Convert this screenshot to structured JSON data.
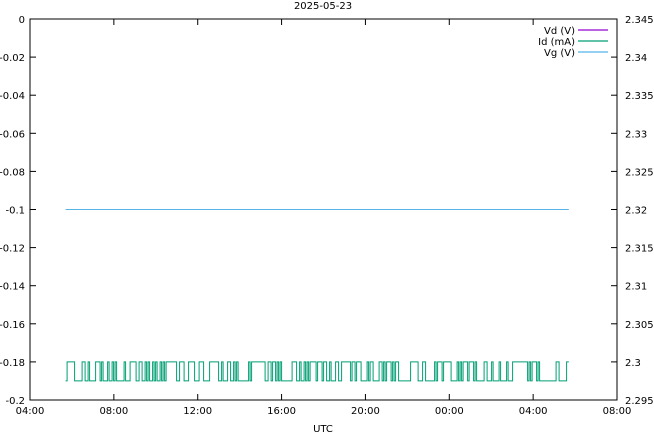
{
  "chart_data": {
    "type": "line",
    "title": "2025-05-23",
    "xlabel": "UTC",
    "ylabel_left": "",
    "ylabel_right": "",
    "x_ticks": [
      "04:00",
      "08:00",
      "12:00",
      "16:00",
      "20:00",
      "00:00",
      "04:00",
      "08:00"
    ],
    "x_range_hours": [
      4,
      32
    ],
    "y_left_range": [
      -0.2,
      0
    ],
    "y_left_ticks": [
      "0",
      "-0.02",
      "-0.04",
      "-0.06",
      "-0.08",
      "-0.1",
      "-0.12",
      "-0.14",
      "-0.16",
      "-0.18",
      "-0.2"
    ],
    "y_right_range": [
      2.295,
      2.345
    ],
    "y_right_ticks": [
      "2.345",
      "2.34",
      "2.335",
      "2.33",
      "2.325",
      "2.32",
      "2.315",
      "2.31",
      "2.305",
      "2.3",
      "2.295"
    ],
    "legend_position": "top-right",
    "grid": false,
    "series": [
      {
        "name": "Vd (V)",
        "color": "#9400d3",
        "axis": "right",
        "t_start_hours": 5.7,
        "t_end_hours": 29.7,
        "value": null,
        "note": "not visible in plotted range"
      },
      {
        "name": "Id (mA)",
        "color": "#009e73",
        "axis": "left",
        "t_start_hours": 5.7,
        "t_end_hours": 29.7,
        "values_between": [
          -0.19,
          -0.18
        ],
        "pattern": "noisy square wave toggling between -0.18 and -0.19"
      },
      {
        "name": "Vg (V)",
        "color": "#56b4e9",
        "axis": "left",
        "t_start_hours": 5.7,
        "t_end_hours": 29.7,
        "value": -0.1
      }
    ]
  }
}
